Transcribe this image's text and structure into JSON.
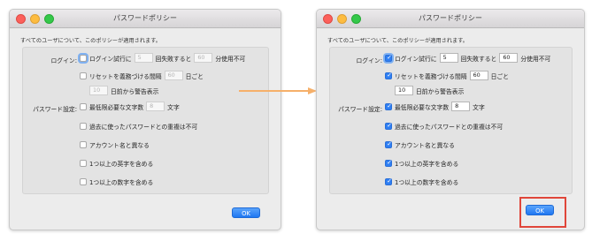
{
  "left": {
    "title": "パスワードポリシー",
    "note": "すべてのユーザについて、このポリシーが適用されます。",
    "login_label": "ログイン:",
    "login_attempts_text": "ログイン試行に",
    "login_attempts_value": "5",
    "login_fail_text": "回失敗すると",
    "login_lock_value": "60",
    "login_lock_text": "分使用不可",
    "reset_text": "リセットを義務づける間隔",
    "reset_value": "60",
    "reset_unit": "日ごと",
    "warn_value": "10",
    "warn_text": "日前から警告表示",
    "password_label": "パスワード設定:",
    "minlen_text": "最低限必要な文字数",
    "minlen_value": "8",
    "minlen_unit": "文字",
    "no_reuse_text": "過去に使ったパスワードとの重複は不可",
    "differ_account_text": "アカウント名と異なる",
    "one_letter_text": "1つ以上の英字を含める",
    "one_digit_text": "1つ以上の数字を含める",
    "ok_label": "OK"
  },
  "right": {
    "title": "パスワードポリシー",
    "note": "すべてのユーザについて、このポリシーが適用されます。",
    "login_label": "ログイン:",
    "login_attempts_text": "ログイン試行に",
    "login_attempts_value": "5",
    "login_fail_text": "回失敗すると",
    "login_lock_value": "60",
    "login_lock_text": "分使用不可",
    "reset_text": "リセットを義務づける間隔",
    "reset_value": "60",
    "reset_unit": "日ごと",
    "warn_value": "10",
    "warn_text": "日前から警告表示",
    "password_label": "パスワード設定:",
    "minlen_text": "最低限必要な文字数",
    "minlen_value": "8",
    "minlen_unit": "文字",
    "no_reuse_text": "過去に使ったパスワードとの重複は不可",
    "differ_account_text": "アカウント名と異なる",
    "one_letter_text": "1つ以上の英字を含める",
    "one_digit_text": "1つ以上の数字を含める",
    "ok_label": "OK"
  },
  "colors": {
    "accent": "#2f7ff3",
    "arrow": "#f6b06a",
    "highlight": "#e0463a"
  }
}
